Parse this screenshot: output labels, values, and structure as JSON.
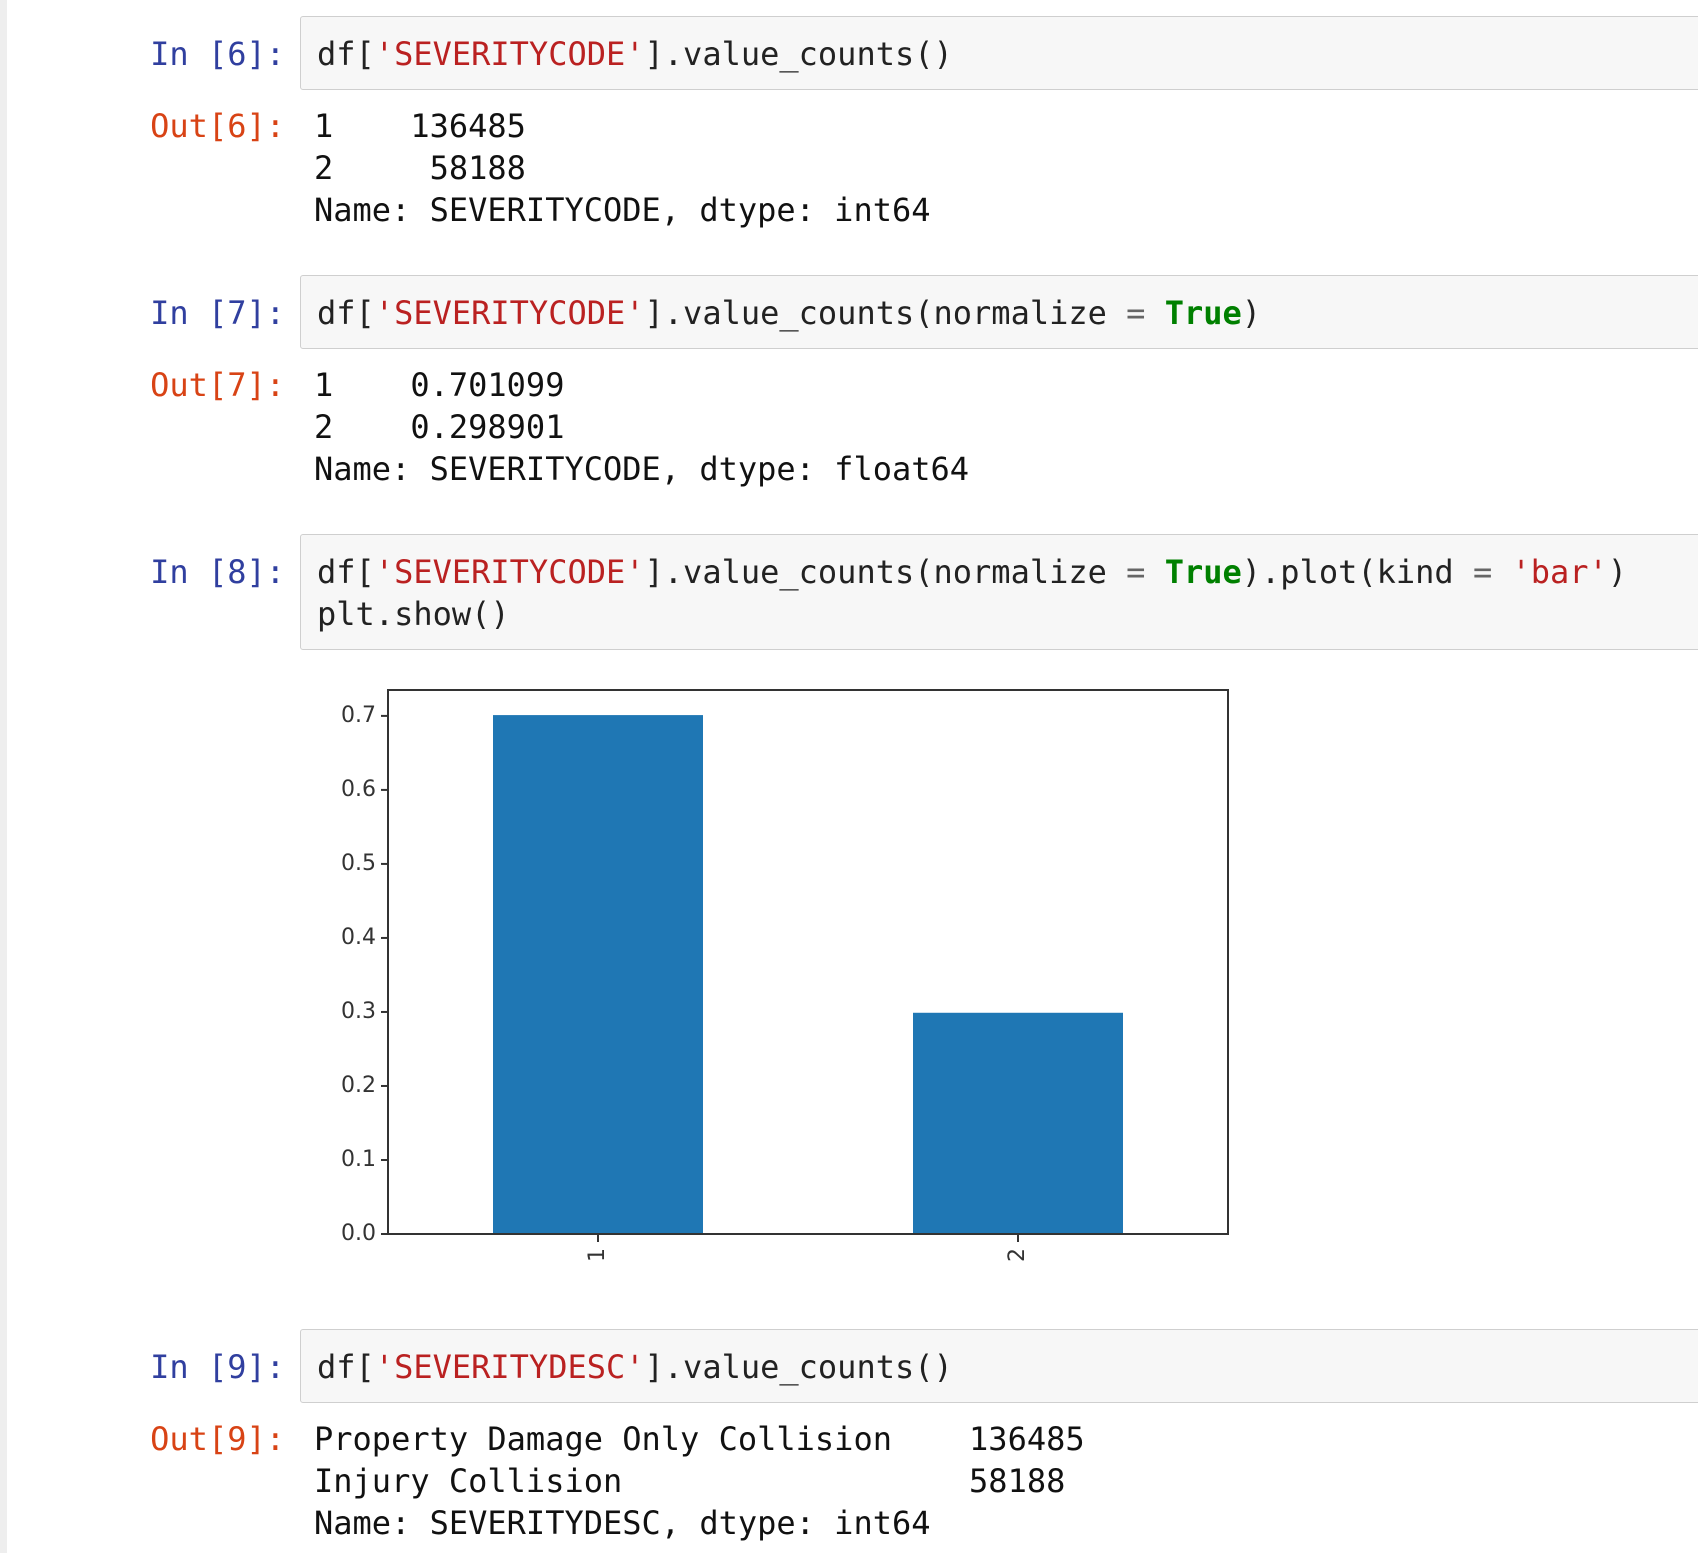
{
  "cells": [
    {
      "in_prompt": "In [6]:",
      "code": {
        "pre": "df[",
        "str1": "'SEVERITYCODE'",
        "post": "].value_counts()"
      },
      "out_prompt": "Out[6]:",
      "output": [
        "1    136485",
        "2     58188",
        "Name: SEVERITYCODE, dtype: int64"
      ]
    },
    {
      "in_prompt": "In [7]:",
      "code": {
        "pre": "df[",
        "str1": "'SEVERITYCODE'",
        "mid": "].value_counts(normalize ",
        "eq": "=",
        "sp": " ",
        "kw": "True",
        "post": ")"
      },
      "out_prompt": "Out[7]:",
      "output": [
        "1    0.701099",
        "2    0.298901",
        "Name: SEVERITYCODE, dtype: float64"
      ]
    },
    {
      "in_prompt": "In [8]:",
      "code": {
        "pre": "df[",
        "str1": "'SEVERITYCODE'",
        "mid": "].value_counts(normalize ",
        "eq": "=",
        "sp": " ",
        "kw": "True",
        "mid2": ").plot(kind ",
        "eq2": "=",
        "sp2": " ",
        "str2": "'bar'",
        "post": ")",
        "line2": "plt.show()"
      }
    },
    {
      "in_prompt": "In [9]:",
      "code": {
        "pre": "df[",
        "str1": "'SEVERITYDESC'",
        "post": "].value_counts()"
      },
      "out_prompt": "Out[9]:",
      "output": [
        "Property Damage Only Collision    136485",
        "Injury Collision                  58188",
        "Name: SEVERITYDESC, dtype: int64"
      ]
    }
  ],
  "colors": {
    "in_prompt": "#303f9f",
    "out_prompt": "#d84315",
    "string": "#ba2121",
    "keyword": "#008000",
    "bar": "#1f77b4"
  },
  "chart_data": {
    "type": "bar",
    "categories": [
      "1",
      "2"
    ],
    "values": [
      0.701099,
      0.298901
    ],
    "ylim": [
      0,
      0.735
    ],
    "yticks": [
      "0.0",
      "0.1",
      "0.2",
      "0.3",
      "0.4",
      "0.5",
      "0.6",
      "0.7"
    ],
    "xtick_rotation": "vertical",
    "grid": false,
    "legend": "none"
  }
}
